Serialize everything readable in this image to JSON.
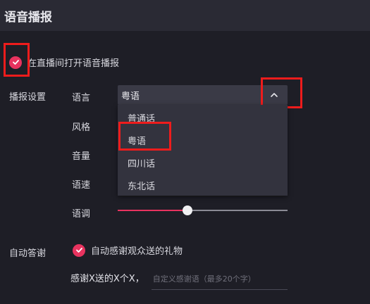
{
  "header": {
    "title": "语音播报"
  },
  "enable": {
    "label": "在直播间打开语音播报",
    "checked": true
  },
  "settings": {
    "section_label": "播报设置",
    "language_label": "语言",
    "style_label": "风格",
    "volume_label": "音量",
    "speed_label": "语速",
    "pitch_label": "语调",
    "language_selected": "粤语",
    "language_options": [
      "普通话",
      "粤语",
      "四川话",
      "东北话"
    ],
    "pitch_level_percent": 41
  },
  "auto_thanks": {
    "section_label": "自动答谢",
    "checkbox_label": "自动感谢观众送的礼物",
    "checked": true,
    "prefix": "感谢X送的X个X，",
    "placeholder": "自定义感谢语（最多20个字）"
  },
  "colors": {
    "accent": "#e8335f",
    "highlight_box": "#ee1c1c",
    "background": "#1e1e26",
    "header_background": "#2a2a34"
  },
  "icons": {
    "check": "check-icon",
    "dropdown_toggle": "chevron-up-icon"
  }
}
